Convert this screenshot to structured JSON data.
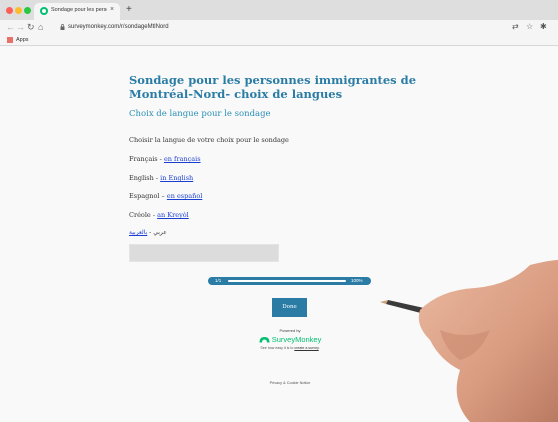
{
  "browser": {
    "tab_title": "Sondage pour les personnes i",
    "tab_close": "×",
    "new_tab": "+",
    "url": "surveymonkey.com/r/sondageMtlNord",
    "bookmarks_apps": "Apps"
  },
  "survey": {
    "title": "Sondage pour les personnes immigrantes de Montréal-Nord- choix de langues",
    "subtitle": "Choix de langue pour le sondage",
    "question": "Choisir la langue de votre choix pour le sondage",
    "languages": [
      {
        "name": "Français",
        "sep": " - ",
        "link": "en français"
      },
      {
        "name": "English",
        "sep": " - ",
        "link": "in English"
      },
      {
        "name": "Espagnol",
        "sep": " – ",
        "link": "en español"
      },
      {
        "name": "Créole",
        "sep": " - ",
        "link": "an Kreyòl"
      },
      {
        "name": "عربي",
        "sep": " - ",
        "link": "بالعربية"
      }
    ],
    "progress": {
      "label": "1/1",
      "percent_text": "100%",
      "fraction": 1.0
    },
    "done_label": "Done"
  },
  "footer": {
    "powered_by": "Powered by",
    "brand": "SurveyMonkey",
    "note_prefix": "See how easy it is to ",
    "note_link": "create a survey",
    "note_suffix": ".",
    "privacy": "Privacy & Cookie Notice"
  },
  "colors": {
    "accent": "#2a7ca5",
    "link": "#1a3fd0",
    "brand_green": "#00bf6f"
  }
}
